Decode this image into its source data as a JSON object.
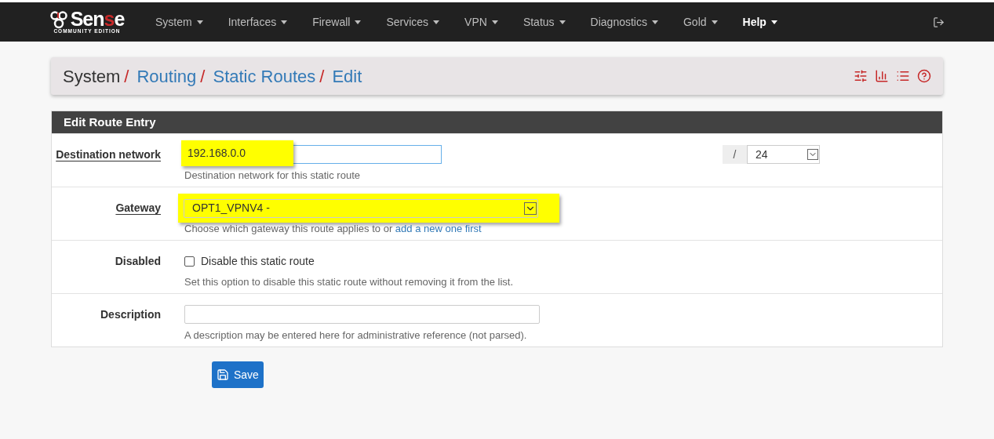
{
  "navbar": {
    "logo": {
      "wordmark": [
        {
          "text": "Sen",
          "accent": false
        },
        {
          "text": "s",
          "accent": true
        },
        {
          "text": "e",
          "accent": false
        }
      ],
      "subtitle": "COMMUNITY EDITION"
    },
    "items": [
      {
        "label": "System",
        "selected": false
      },
      {
        "label": "Interfaces",
        "selected": false
      },
      {
        "label": "Firewall",
        "selected": false
      },
      {
        "label": "Services",
        "selected": false
      },
      {
        "label": "VPN",
        "selected": false
      },
      {
        "label": "Status",
        "selected": false
      },
      {
        "label": "Diagnostics",
        "selected": false
      },
      {
        "label": "Gold",
        "selected": false
      },
      {
        "label": "Help",
        "selected": true
      }
    ]
  },
  "breadcrumb": [
    {
      "label": "System",
      "link": false,
      "separator": "/"
    },
    {
      "label": "Routing",
      "link": true,
      "separator": "/"
    },
    {
      "label": "Static Routes",
      "link": true,
      "separator": "/"
    },
    {
      "label": "Edit",
      "link": true
    }
  ],
  "panel": {
    "title": "Edit Route Entry",
    "rows": [
      {
        "kind": "network",
        "label": "Destination network",
        "required": true,
        "value": "192.168.0.0",
        "highlighted": true,
        "separator": "/",
        "mask": "24",
        "help": "Destination network for this static route"
      },
      {
        "kind": "select",
        "label": "Gateway",
        "required": true,
        "value": "OPT1_VPNV4 -",
        "highlighted": true,
        "help": "Choose which gateway this route applies to or ",
        "help_link": "add a new one first"
      },
      {
        "kind": "checkbox",
        "label": "Disabled",
        "required": false,
        "checked": false,
        "checkbox_label": "Disable this static route",
        "help": "Set this option to disable this static route without removing it from the list."
      },
      {
        "kind": "text",
        "label": "Description",
        "required": false,
        "help": "A description may be entered here for administrative reference (not parsed)."
      }
    ]
  },
  "save_button": "Save"
}
